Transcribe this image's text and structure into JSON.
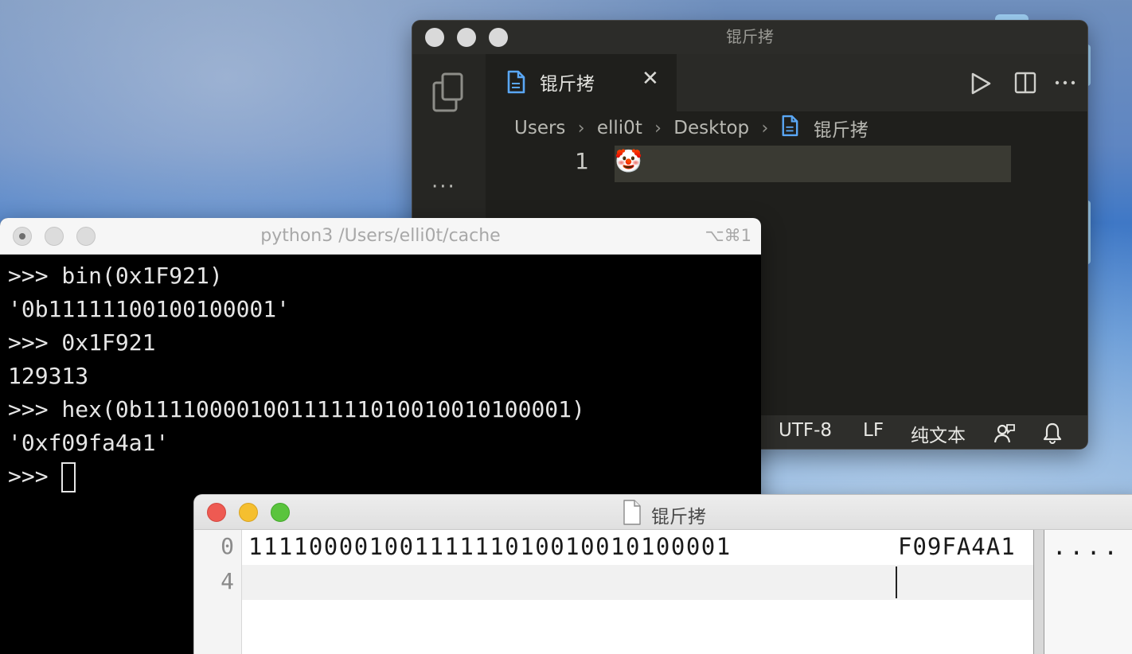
{
  "vscode": {
    "window_title": "锟斤拷",
    "tab": {
      "label": "锟斤拷",
      "close": "✕"
    },
    "activity": {
      "more": "···"
    },
    "breadcrumb": [
      "Users",
      "elli0t",
      "Desktop",
      "锟斤拷"
    ],
    "breadcrumb_separator": "›",
    "editor": {
      "line_number": "1",
      "content": "🤡"
    },
    "status": {
      "encoding": "UTF-8",
      "eol": "LF",
      "language": "纯文本"
    }
  },
  "terminal": {
    "title": "python3 /Users/elli0t/cache",
    "shortcut": "⌥⌘1",
    "lines": [
      ">>> bin(0x1F921)",
      "'0b11111100100100001'",
      ">>> 0x1F921",
      "129313",
      ">>> hex(0b11110000100111111010010010100001)",
      "'0xf09fa4a1'"
    ],
    "prompt": ">>> "
  },
  "hex_editor": {
    "title": "锟斤拷",
    "offsets": [
      "0",
      "4"
    ],
    "bits": "11110000100111111010010010100001",
    "hex": "F09FA4A1",
    "ascii": "...."
  },
  "colors": {
    "traffic_red": "#ee5a52",
    "traffic_yellow": "#f5bf2f",
    "traffic_green": "#5ac43d",
    "vscode_file_icon": "#5aa7f5"
  }
}
